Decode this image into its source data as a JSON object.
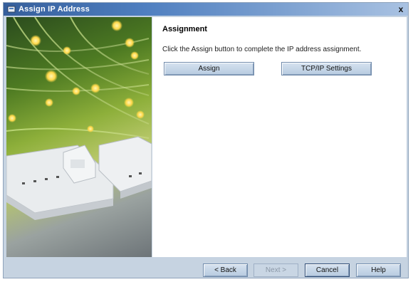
{
  "window": {
    "title": "Assign IP Address",
    "close_glyph": "x"
  },
  "content": {
    "section_title": "Assignment",
    "instruction": "Click the Assign button to complete the IP address assignment."
  },
  "buttons": {
    "assign": "Assign",
    "tcpip": "TCP/IP Settings"
  },
  "footer": {
    "back": "< Back",
    "next": "Next >",
    "cancel": "Cancel",
    "help": "Help"
  },
  "colors": {
    "title_bar_start": "#355e9b",
    "frame": "#c6d3e1",
    "button_face": "#c7d7e8"
  },
  "icons": {
    "title": "app-icon",
    "close": "close-icon"
  }
}
